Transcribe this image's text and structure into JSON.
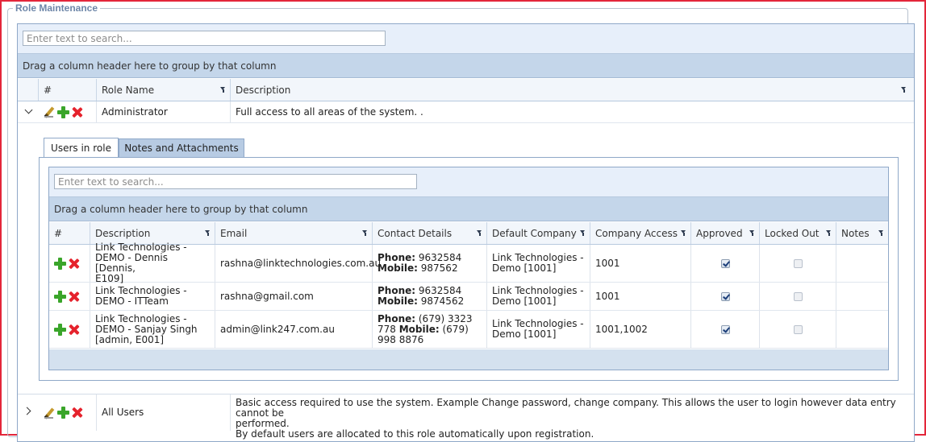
{
  "panel": {
    "title": "Role Maintenance"
  },
  "outer_grid": {
    "search_placeholder": "Enter text to search...",
    "group_hint": "Drag a column header here to group by that column",
    "headers": {
      "num": "#",
      "role_name": "Role Name",
      "description": "Description"
    },
    "rows": [
      {
        "role_name": "Administrator",
        "description": "Full access to all areas of the system. .",
        "expanded": true
      },
      {
        "role_name": "All Users",
        "description_lines": [
          "Basic access required to use the system. Example Change password, change company. This allows the user to login however data entry cannot be",
          "performed.",
          "By default users are allocated to this role automatically upon registration."
        ],
        "expanded": false
      }
    ]
  },
  "detail": {
    "tabs": [
      {
        "label": "Users in role",
        "active": true
      },
      {
        "label": "Notes and Attachments",
        "active": false
      }
    ],
    "inner_grid": {
      "search_placeholder": "Enter text to search...",
      "group_hint": "Drag a column header here to group by that column",
      "headers": {
        "num": "#",
        "description": "Description",
        "email": "Email",
        "contact": "Contact Details",
        "company": "Default Company",
        "access": "Company Access",
        "approved": "Approved",
        "locked": "Locked Out",
        "notes": "Notes"
      },
      "phone_label": "Phone:",
      "mobile_label": "Mobile:",
      "rows": [
        {
          "description_lines": [
            "Link Technologies -",
            "DEMO - Dennis [Dennis,",
            "E109]"
          ],
          "email": "rashna@linktechnologies.com.au",
          "contact_line1_value": " 9632584",
          "contact_line2_value": " 987562",
          "company_lines": [
            "Link Technologies -",
            "Demo [1001]"
          ],
          "access": "1001",
          "approved": true,
          "locked": false
        },
        {
          "description_lines": [
            "Link Technologies -",
            "DEMO - ITTeam"
          ],
          "email": "rashna@gmail.com",
          "contact_line1_value": " 9632584",
          "contact_line2_value": " 9874562",
          "company_lines": [
            "Link Technologies -",
            "Demo [1001]"
          ],
          "access": "1001",
          "approved": true,
          "locked": false
        },
        {
          "description_lines": [
            "Link Technologies -",
            "DEMO - Sanjay Singh",
            "[admin, E001]"
          ],
          "email": "admin@link247.com.au",
          "contact_line1_value": " (679) 3323",
          "contact_line2_prefix": "778 ",
          "contact_line2_value": " (679)",
          "contact_line3": "998 8876",
          "company_lines": [
            "Link Technologies -",
            "Demo [1001]"
          ],
          "access": "1001,1002",
          "approved": true,
          "locked": false
        }
      ]
    }
  },
  "icons": {
    "edit": "edit-pencil-icon",
    "add": "add-plus-icon",
    "delete": "delete-x-icon",
    "filter": "filter-icon"
  },
  "colors": {
    "border_red": "#e3263a",
    "group_bar": "#c4d6ea",
    "search_bar": "#e7effa",
    "add_green": "#3aa52a",
    "delete_red": "#e5222c"
  }
}
